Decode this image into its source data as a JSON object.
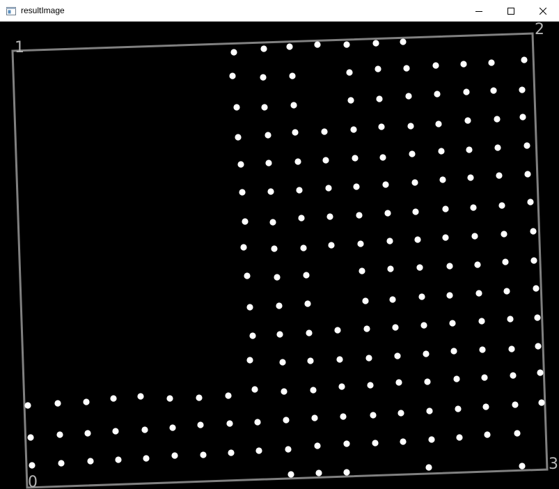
{
  "window": {
    "title": "resultImage",
    "controls": [
      "minimize-icon",
      "maximize-icon",
      "close-icon"
    ]
  },
  "image": {
    "background_color": "#000000",
    "quad_color": "#808080",
    "dot_color": "#ffffff",
    "corner_label_color": "#b4b4b4",
    "corner_labels": [
      "0",
      "1",
      "2",
      "3"
    ]
  }
}
